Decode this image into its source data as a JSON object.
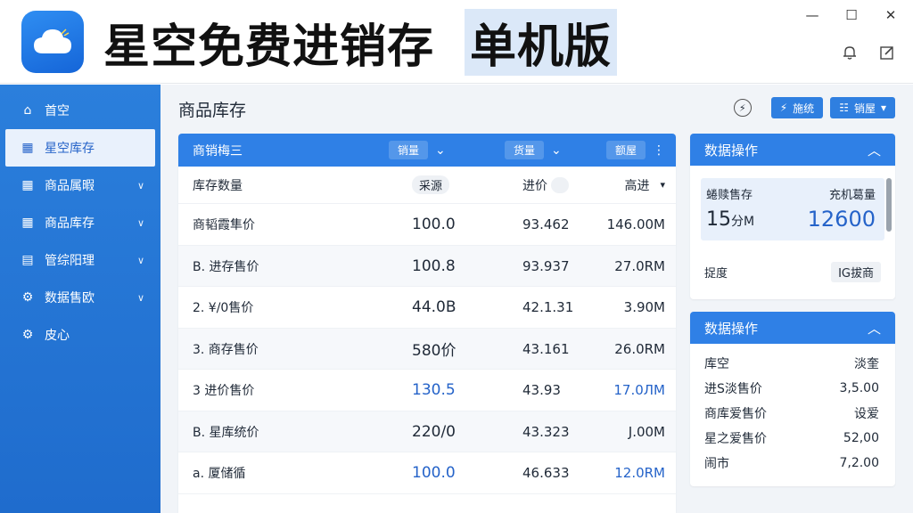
{
  "app": {
    "title": "星空免费进销存",
    "tag": "单机版"
  },
  "window": {
    "minimize": "—",
    "maximize": "☐",
    "close": "✕"
  },
  "sidebar": {
    "items": [
      {
        "label": "首空",
        "icon": "home-icon",
        "glyph": "⌂"
      },
      {
        "label": "星空库存",
        "icon": "grid-icon",
        "glyph": "▦"
      },
      {
        "label": "商品属暇",
        "icon": "grid-icon",
        "glyph": "▦"
      },
      {
        "label": "商品库存",
        "icon": "grid-icon",
        "glyph": "▦"
      },
      {
        "label": "管综阳理",
        "icon": "clipboard-icon",
        "glyph": "▤"
      },
      {
        "label": "数据售欧",
        "icon": "gear-icon",
        "glyph": "⚙"
      },
      {
        "label": "皮心",
        "icon": "gear-icon",
        "glyph": "⚙"
      }
    ]
  },
  "page": {
    "title": "商品库存",
    "btn1": "施统",
    "btn2": "销屋"
  },
  "table": {
    "head": {
      "title": "商销梅三",
      "filter1": "销量",
      "filter2": "货量",
      "filter3": "额屋"
    },
    "columns": [
      "库存数量",
      "采源",
      "进价",
      "高进"
    ],
    "rows": [
      {
        "name": "商韬霞隼价",
        "qty": "100.0",
        "price": "93.462",
        "total": "146.00M",
        "highlight": false
      },
      {
        "name": "B. 进存售价",
        "qty": "100.8",
        "price": "93.937",
        "total": "27.0RM",
        "highlight": false
      },
      {
        "name": "2. ¥/0售价",
        "qty": "44.0B",
        "price": "42.1.31",
        "total": "3.90M",
        "highlight": false
      },
      {
        "name": "3. 商存售价",
        "qty": "580价",
        "price": "43.161",
        "total": "26.0RM",
        "highlight": false
      },
      {
        "name": "3  进价售价",
        "qty": "130.5",
        "price": "43.93",
        "total": "17.0ЛM",
        "highlight": true
      },
      {
        "name": "B. 星库统价",
        "qty": "220/0",
        "price": "43.323",
        "total": "J.00M",
        "highlight": false
      },
      {
        "name": "a. 厦储循",
        "qty": "100.0",
        "price": "46.633",
        "total": "12.0RM",
        "highlight": true
      }
    ]
  },
  "card1": {
    "title": "数据操作",
    "label_left": "蜷赎售存",
    "label_right": "充机葛量",
    "value_left": "15",
    "value_left_suffix": "分M",
    "value_right": "12600",
    "line_label": "捉度",
    "line_value": "IG拔商"
  },
  "card2": {
    "title": "数据操作",
    "items": [
      {
        "label": "库空",
        "value": "淡奎"
      },
      {
        "label": "进S淡售价",
        "value": "3,5.00"
      },
      {
        "label": "商库爱售价",
        "value": "设爱"
      },
      {
        "label": "星之爱售价",
        "value": "52,00"
      },
      {
        "label": "闹市",
        "value": "7,2.00"
      }
    ]
  },
  "colors": {
    "sidebar": "#2b7fdc",
    "accent": "#2f80e6",
    "highlight_text": "#2563c9"
  }
}
